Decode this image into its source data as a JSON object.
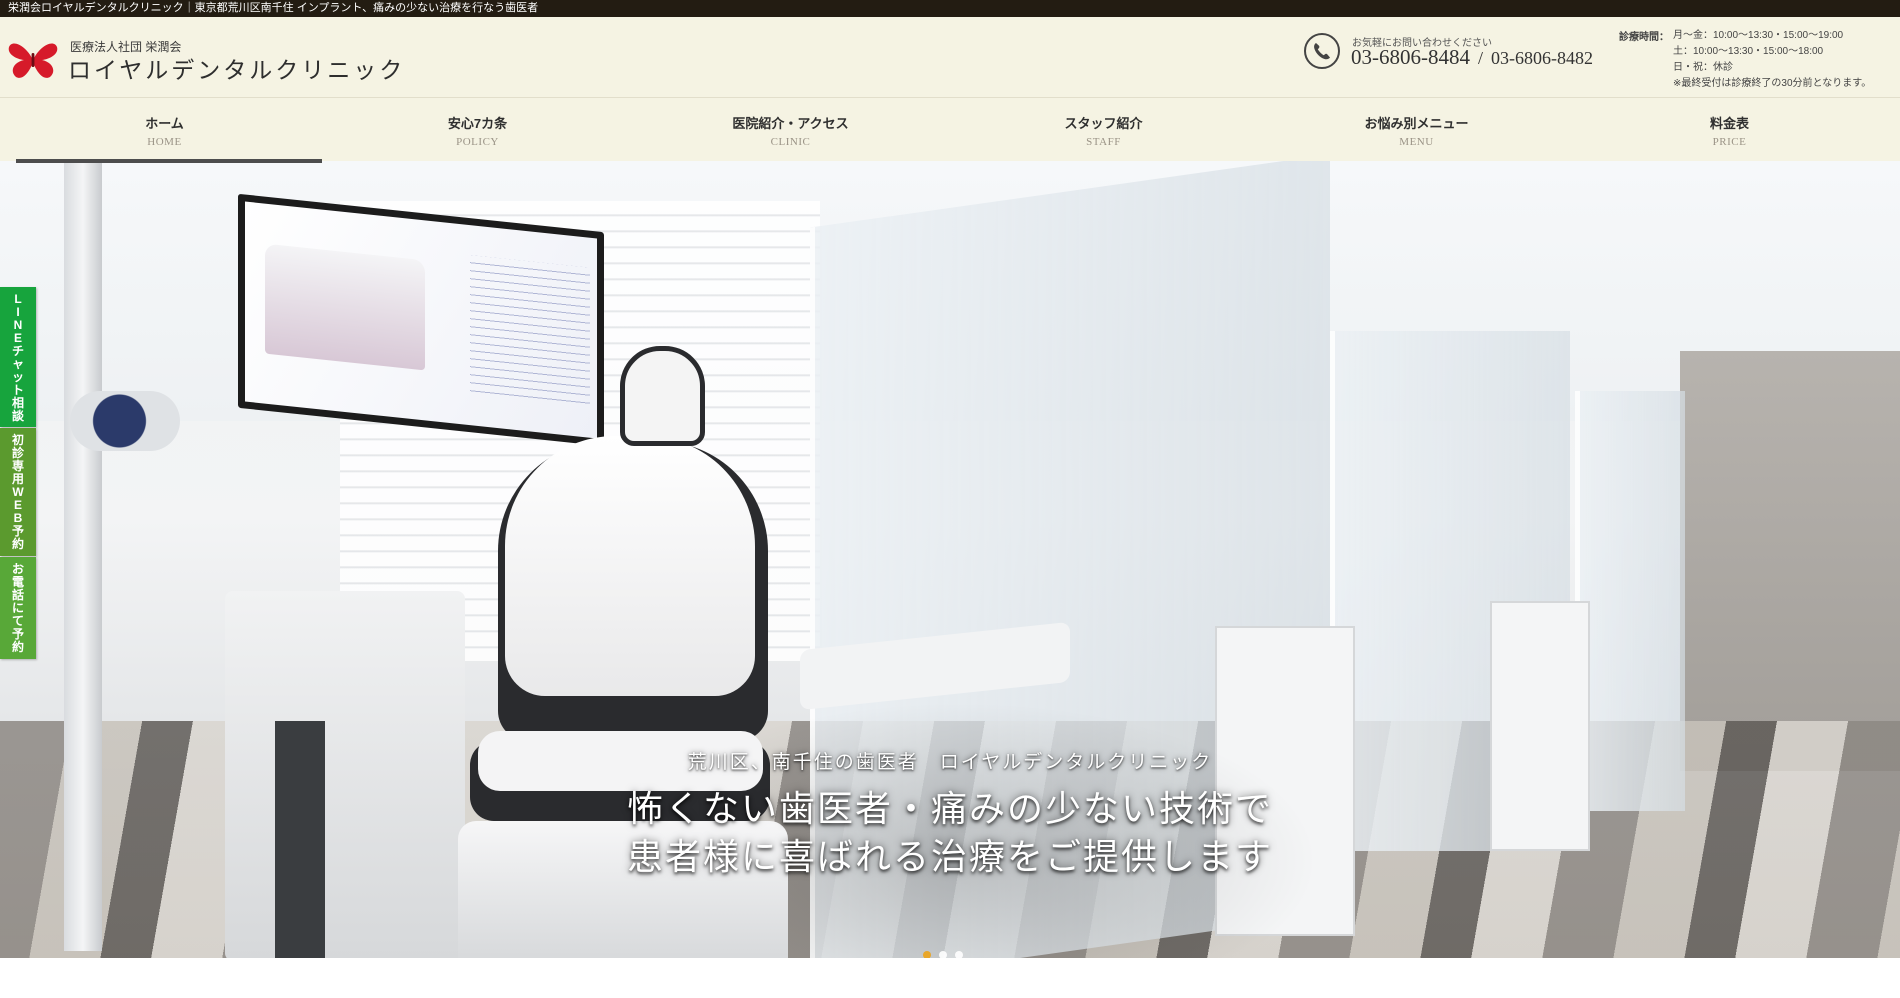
{
  "topbar": {
    "text": "栄潤会ロイヤルデンタルクリニック｜東京都荒川区南千住 インプラント、痛みの少ない治療を行なう歯医者"
  },
  "header": {
    "corp_name": "医療法人社団 栄潤会",
    "clinic_name": "ロイヤルデンタルクリニック",
    "logo_icon": "butterfly-logo-icon",
    "accent_color": "#d61a2a",
    "contact": {
      "icon": "phone-icon",
      "note": "お気軽にお問い合わせください",
      "tel1": "03-6806-8484",
      "separator": "/",
      "tel2": "03-6806-8482"
    },
    "hours": {
      "label": "診療時間：",
      "lines": [
        "月〜金：10:00〜13:30・15:00〜19:00",
        "土：10:00〜13:30・15:00〜18:00",
        "日・祝：休診",
        "※最終受付は診療終了の30分前となります。"
      ]
    }
  },
  "nav": {
    "items": [
      {
        "jp": "ホーム",
        "en": "HOME",
        "active": true
      },
      {
        "jp": "安心7カ条",
        "en": "POLICY",
        "active": false
      },
      {
        "jp": "医院紹介・アクセス",
        "en": "CLINIC",
        "active": false
      },
      {
        "jp": "スタッフ紹介",
        "en": "STAFF",
        "active": false
      },
      {
        "jp": "お悩み別メニュー",
        "en": "MENU",
        "active": false
      },
      {
        "jp": "料金表",
        "en": "PRICE",
        "active": false
      }
    ]
  },
  "side_buttons": [
    {
      "label": "LINEチャット相談",
      "color": "#17a43d"
    },
    {
      "label": "初診専用WEB予約",
      "color": "#5b9a2e"
    },
    {
      "label": "お電話にて予約",
      "color": "#58a838"
    }
  ],
  "hero": {
    "subtitle": "荒川区、南千住の歯医者　ロイヤルデンタルクリニック",
    "title_line1": "怖くない歯医者・痛みの少ない技術で",
    "title_line2": "患者様に喜ばれる治療をご提供します",
    "slides_total": 3,
    "active_slide": 1,
    "active_dot_color": "#e8a62a"
  }
}
